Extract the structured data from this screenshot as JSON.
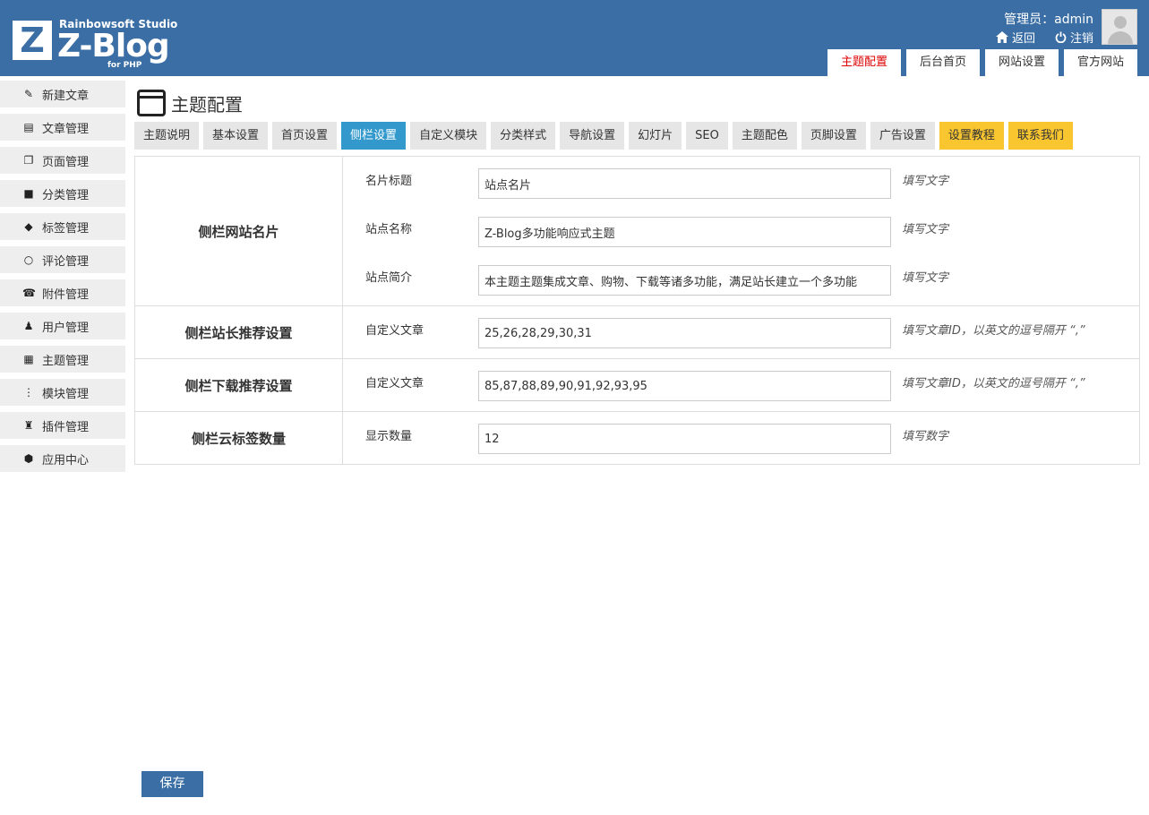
{
  "header": {
    "studio": "Rainbowsoft Studio",
    "logo_letter": "Z",
    "brand": "Z-Blog",
    "brand_sub": "for PHP",
    "user_label": "管理员：admin",
    "back_label": "返回",
    "logout_label": "注销",
    "tabs": [
      "主题配置",
      "后台首页",
      "网站设置",
      "官方网站"
    ]
  },
  "sidebar": {
    "items": [
      {
        "label": "新建文章",
        "icon": "edit-icon"
      },
      {
        "label": "文章管理",
        "icon": "document-icon"
      },
      {
        "label": "页面管理",
        "icon": "pages-icon"
      },
      {
        "label": "分类管理",
        "icon": "folder-icon"
      },
      {
        "label": "标签管理",
        "icon": "tag-icon"
      },
      {
        "label": "评论管理",
        "icon": "comment-icon"
      },
      {
        "label": "附件管理",
        "icon": "attachment-icon"
      },
      {
        "label": "用户管理",
        "icon": "user-icon"
      },
      {
        "label": "主题管理",
        "icon": "theme-icon"
      },
      {
        "label": "模块管理",
        "icon": "module-icon"
      },
      {
        "label": "插件管理",
        "icon": "plugin-icon"
      },
      {
        "label": "应用中心",
        "icon": "box-icon"
      }
    ]
  },
  "main": {
    "title": "主题配置",
    "tabs": [
      "主题说明",
      "基本设置",
      "首页设置",
      "侧栏设置",
      "自定义模块",
      "分类样式",
      "导航设置",
      "幻灯片",
      "SEO",
      "主题配色",
      "页脚设置",
      "广告设置",
      "设置教程",
      "联系我们"
    ],
    "active_tab": "侧栏设置",
    "sections": [
      {
        "label": "侧栏网站名片",
        "fields": [
          {
            "label": "名片标题",
            "value": "站点名片",
            "note": "填写文字"
          },
          {
            "label": "站点名称",
            "value": "Z-Blog多功能响应式主题",
            "note": "填写文字"
          },
          {
            "label": "站点简介",
            "value": "本主题主题集成文章、购物、下载等诸多功能，满足站长建立一个多功能",
            "note": "填写文字"
          }
        ]
      },
      {
        "label": "侧栏站长推荐设置",
        "fields": [
          {
            "label": "自定义文章",
            "value": "25,26,28,29,30,31",
            "note": "填写文章ID，以英文的逗号隔开 “,”"
          }
        ]
      },
      {
        "label": "侧栏下载推荐设置",
        "fields": [
          {
            "label": "自定义文章",
            "value": "85,87,88,89,90,91,92,93,95",
            "note": "填写文章ID，以英文的逗号隔开 “,”"
          }
        ]
      },
      {
        "label": "侧栏云标签数量",
        "fields": [
          {
            "label": "显示数量",
            "value": "12",
            "note": "填写数字"
          }
        ]
      }
    ],
    "save_label": "保存"
  },
  "colors": {
    "header_bg": "#3a6ea5",
    "active_tab_bg": "#3399cc",
    "highlight_tab_bg": "#f9c630",
    "active_top_tab_text": "#dd0000"
  }
}
